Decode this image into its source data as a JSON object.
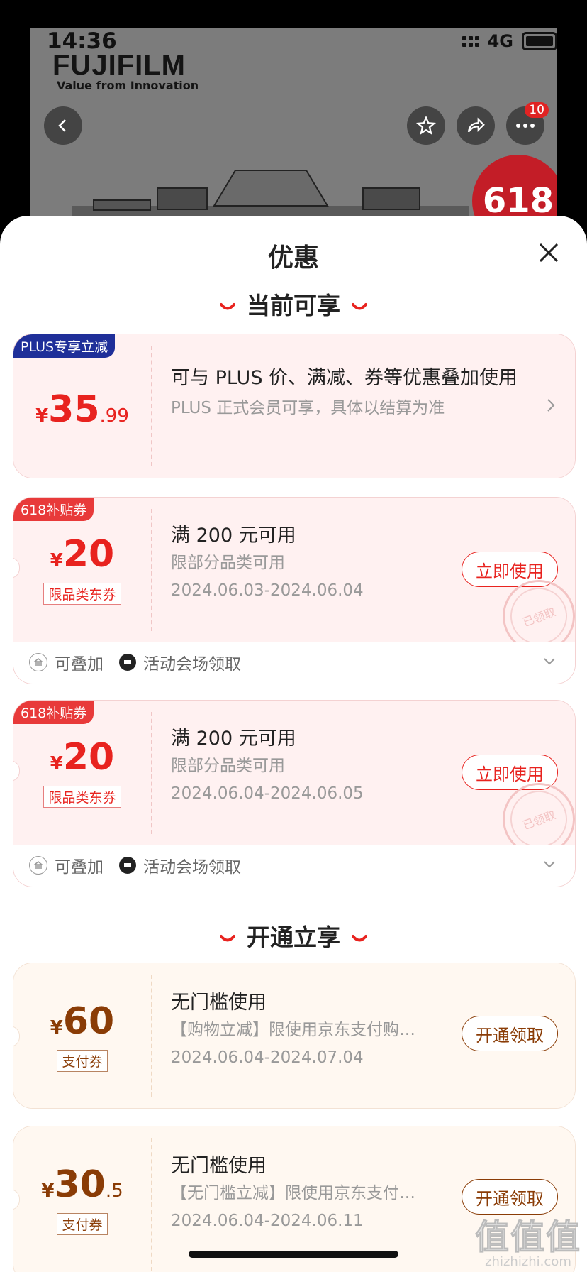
{
  "status_bar": {
    "time": "14:36",
    "network": "4G"
  },
  "background_page": {
    "brand": "FUJIFILM",
    "tagline": "Value from Innovation",
    "more_badge": "10",
    "promo": "618"
  },
  "sheet": {
    "title": "优惠",
    "section_current": "当前可享",
    "section_activate": "开通立享"
  },
  "plus_card": {
    "tag": "PLUS专享立减",
    "yen": "¥",
    "amount_int": "35",
    "amount_dec": ".99",
    "title": "可与 PLUS 价、满减、券等优惠叠加使用",
    "subtitle": "PLUS 正式会员可享，具体以结算为准"
  },
  "coupons": [
    {
      "tag": "618补贴券",
      "yen": "¥",
      "amount": "20",
      "type": "限品类东券",
      "title": "满 200 元可用",
      "scope": "限部分品类可用",
      "dates": "2024.06.03-2024.06.04",
      "action": "立即使用",
      "stamp": "已领取",
      "feature_stack": "可叠加",
      "feature_source": "活动会场领取"
    },
    {
      "tag": "618补贴券",
      "yen": "¥",
      "amount": "20",
      "type": "限品类东券",
      "title": "满 200 元可用",
      "scope": "限部分品类可用",
      "dates": "2024.06.04-2024.06.05",
      "action": "立即使用",
      "stamp": "已领取",
      "feature_stack": "可叠加",
      "feature_source": "活动会场领取"
    }
  ],
  "activate_coupons": [
    {
      "yen": "¥",
      "amount_int": "60",
      "amount_dec": "",
      "type": "支付券",
      "title": "无门槛使用",
      "desc": "【购物立减】限使用京东支付购…",
      "dates": "2024.06.04-2024.07.04",
      "action": "开通领取"
    },
    {
      "yen": "¥",
      "amount_int": "30",
      "amount_dec": ".5",
      "type": "支付券",
      "title": "无门槛使用",
      "desc": "【无门槛立减】限使用京东支付…",
      "dates": "2024.06.04-2024.06.11",
      "action": "开通领取"
    }
  ],
  "watermark": {
    "big": "值值值",
    "small": "zhizhizhi.com"
  }
}
